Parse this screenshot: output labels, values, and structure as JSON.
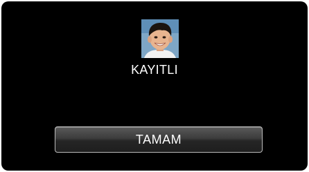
{
  "photo": {
    "icon": "child-face-photo"
  },
  "status": {
    "label": "KAYITLI"
  },
  "actions": {
    "ok_label": "TAMAM"
  }
}
